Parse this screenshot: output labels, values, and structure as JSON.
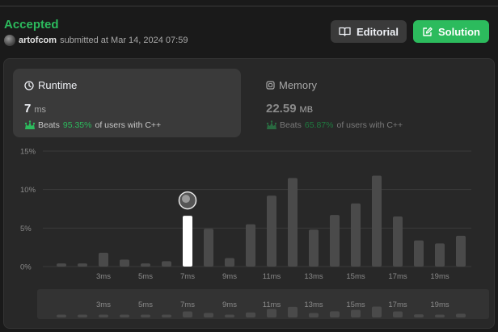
{
  "submission": {
    "status": "Accepted",
    "username": "artofcom",
    "submitted_text": "submitted at Mar 14, 2024 07:59"
  },
  "buttons": {
    "editorial_label": "Editorial",
    "solution_label": "Solution"
  },
  "runtime": {
    "title": "Runtime",
    "value": "7",
    "unit": "ms",
    "beats_label": "Beats",
    "beats_pct": "95.35%",
    "beats_suffix": "of users with C++"
  },
  "memory": {
    "title": "Memory",
    "value": "22.59",
    "unit": "MB",
    "beats_label": "Beats",
    "beats_pct": "65.87%",
    "beats_suffix": "of users with C++"
  },
  "colors": {
    "accent": "#2cbb5d",
    "bar": "#4a4a4a",
    "bar_selected": "#ffffff"
  },
  "chart_data": {
    "type": "bar",
    "y_ticks": [
      "15%",
      "10%",
      "5%",
      "0%"
    ],
    "ylim": [
      0,
      15
    ],
    "x_tick_labels": [
      "3ms",
      "5ms",
      "7ms",
      "9ms",
      "11ms",
      "13ms",
      "15ms",
      "17ms",
      "19ms"
    ],
    "values": [
      0.4,
      0.4,
      1.8,
      0.9,
      0.4,
      0.7,
      6.6,
      4.9,
      1.1,
      5.5,
      9.2,
      11.5,
      4.8,
      6.7,
      8.2,
      11.8,
      6.5,
      3.4,
      3.0,
      4.0
    ],
    "selected_index": 6,
    "grid": true
  }
}
